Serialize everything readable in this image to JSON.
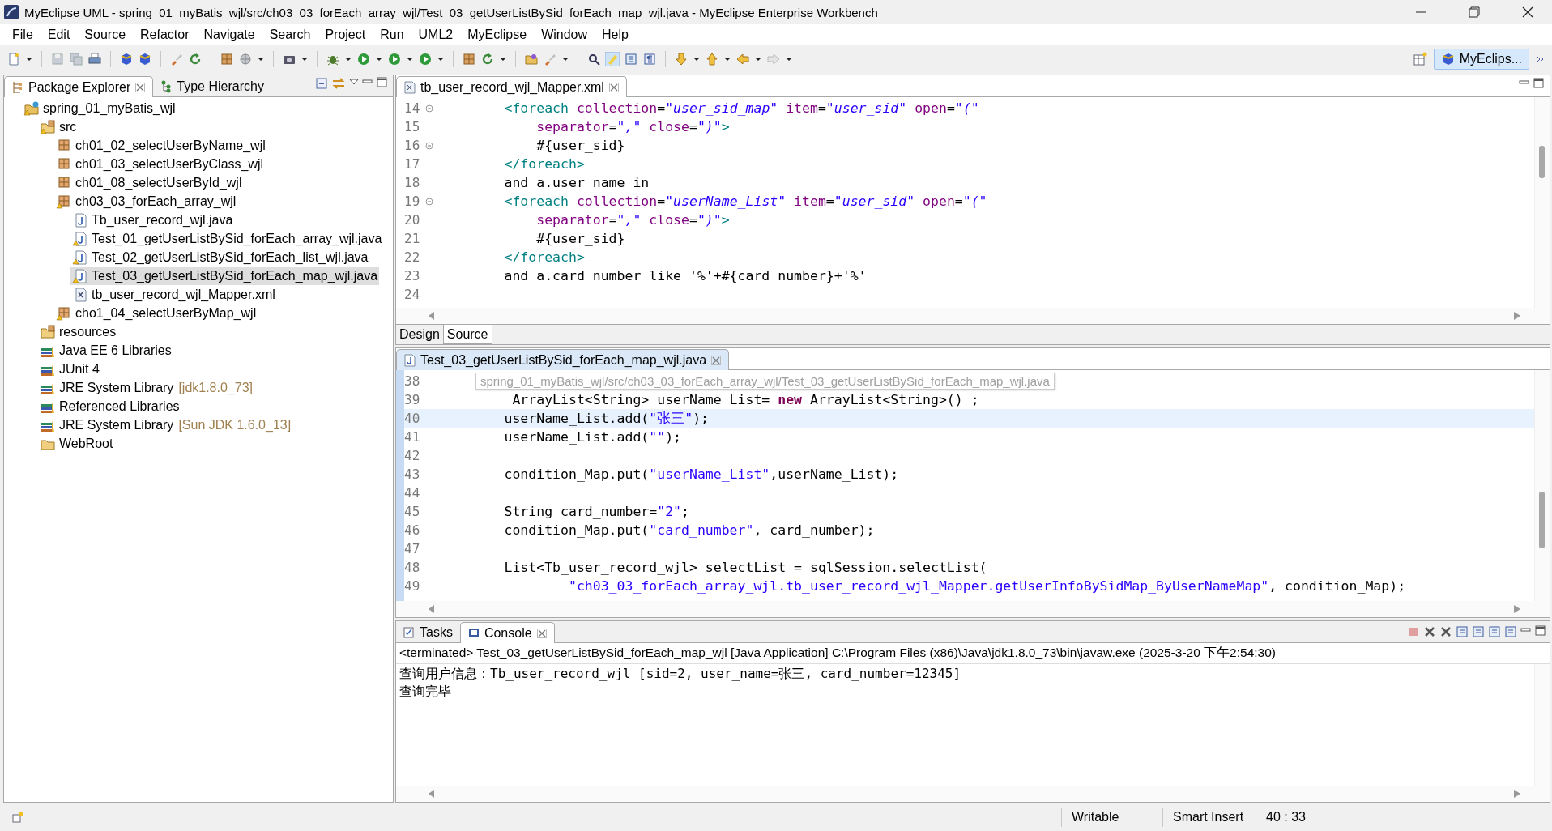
{
  "window": {
    "title": "MyEclipse UML - spring_01_myBatis_wjl/src/ch03_03_forEach_array_wjl/Test_03_getUserListBySid_forEach_map_wjl.java - MyEclipse Enterprise Workbench"
  },
  "menu": [
    "File",
    "Edit",
    "Source",
    "Refactor",
    "Navigate",
    "Search",
    "Project",
    "Run",
    "UML2",
    "MyEclipse",
    "Window",
    "Help"
  ],
  "perspective": {
    "label": "MyEclips...",
    "selected": true
  },
  "explorer": {
    "tabs": [
      {
        "label": "Package Explorer",
        "selected": true
      },
      {
        "label": "Type Hierarchy",
        "selected": false
      }
    ],
    "tree": [
      {
        "label": "spring_01_myBatis_wjl",
        "kind": "project",
        "warning": true,
        "selected": false,
        "children": [
          {
            "label": "src",
            "kind": "source-folder",
            "warning": true,
            "selected": false,
            "children": [
              {
                "label": "ch01_02_selectUserByName_wjl",
                "kind": "package",
                "warning": false,
                "selected": false
              },
              {
                "label": "ch01_03_selectUserByClass_wjl",
                "kind": "package",
                "warning": false,
                "selected": false
              },
              {
                "label": "ch01_08_selectUserById_wjl",
                "kind": "package",
                "warning": false,
                "selected": false
              },
              {
                "label": "ch03_03_forEach_array_wjl",
                "kind": "package",
                "warning": true,
                "selected": false,
                "children": [
                  {
                    "label": "Tb_user_record_wjl.java",
                    "kind": "java",
                    "warning": false,
                    "selected": false
                  },
                  {
                    "label": "Test_01_getUserListBySid_forEach_array_wjl.java",
                    "kind": "java",
                    "warning": true,
                    "selected": false
                  },
                  {
                    "label": "Test_02_getUserListBySid_forEach_list_wjl.java",
                    "kind": "java",
                    "warning": true,
                    "selected": false
                  },
                  {
                    "label": "Test_03_getUserListBySid_forEach_map_wjl.java",
                    "kind": "java",
                    "warning": true,
                    "selected": true
                  },
                  {
                    "label": "tb_user_record_wjl_Mapper.xml",
                    "kind": "xml",
                    "warning": false,
                    "selected": false
                  }
                ]
              },
              {
                "label": "cho1_04_selectUserByMap_wjl",
                "kind": "package",
                "warning": true,
                "selected": false
              }
            ]
          },
          {
            "label": "resources",
            "kind": "source-folder",
            "warning": false,
            "selected": false
          },
          {
            "label": "Java EE 6 Libraries",
            "kind": "library",
            "warning": false,
            "selected": false
          },
          {
            "label": "JUnit 4",
            "kind": "library",
            "warning": false,
            "selected": false
          },
          {
            "label": "JRE System Library",
            "suffix": "[jdk1.8.0_73]",
            "kind": "library",
            "warning": false,
            "selected": false
          },
          {
            "label": "Referenced Libraries",
            "kind": "library",
            "warning": false,
            "selected": false
          },
          {
            "label": "JRE System Library",
            "suffix": "[Sun JDK 1.6.0_13]",
            "kind": "library",
            "warning": false,
            "selected": false
          },
          {
            "label": "WebRoot",
            "kind": "folder",
            "warning": false,
            "selected": false
          }
        ]
      }
    ]
  },
  "xml_editor": {
    "tab": "tb_user_record_wjl_Mapper.xml",
    "lines": [
      {
        "n": "14",
        "fold": true,
        "segs": [
          {
            "kind": "tag",
            "text": "        <foreach"
          },
          {
            "kind": "attr",
            "text": " collection"
          },
          {
            "kind": "text",
            "text": "="
          },
          {
            "kind": "value",
            "text": "\"user_sid_map\""
          },
          {
            "kind": "attr",
            "text": " item"
          },
          {
            "kind": "text",
            "text": "="
          },
          {
            "kind": "value",
            "text": "\"user_sid\""
          },
          {
            "kind": "attr",
            "text": " open"
          },
          {
            "kind": "text",
            "text": "="
          },
          {
            "kind": "value",
            "text": "\"(\""
          }
        ]
      },
      {
        "n": "15",
        "fold": false,
        "segs": [
          {
            "kind": "attr",
            "text": "            separator"
          },
          {
            "kind": "text",
            "text": "="
          },
          {
            "kind": "value",
            "text": "\",\""
          },
          {
            "kind": "attr",
            "text": " close"
          },
          {
            "kind": "text",
            "text": "="
          },
          {
            "kind": "value",
            "text": "\")\""
          },
          {
            "kind": "tag",
            "text": ">"
          }
        ]
      },
      {
        "n": "16",
        "fold": true,
        "segs": [
          {
            "kind": "text",
            "text": "            #{user_sid}"
          }
        ]
      },
      {
        "n": "17",
        "fold": false,
        "segs": [
          {
            "kind": "tag",
            "text": "        </foreach>"
          }
        ]
      },
      {
        "n": "18",
        "fold": false,
        "segs": [
          {
            "kind": "text",
            "text": "        and a.user_name in"
          }
        ]
      },
      {
        "n": "19",
        "fold": true,
        "segs": [
          {
            "kind": "tag",
            "text": "        <foreach"
          },
          {
            "kind": "attr",
            "text": " collection"
          },
          {
            "kind": "text",
            "text": "="
          },
          {
            "kind": "value",
            "text": "\"userName_List\""
          },
          {
            "kind": "attr",
            "text": " item"
          },
          {
            "kind": "text",
            "text": "="
          },
          {
            "kind": "value",
            "text": "\"user_sid\""
          },
          {
            "kind": "attr",
            "text": " open"
          },
          {
            "kind": "text",
            "text": "="
          },
          {
            "kind": "value",
            "text": "\"(\""
          }
        ]
      },
      {
        "n": "20",
        "fold": false,
        "segs": [
          {
            "kind": "attr",
            "text": "            separator"
          },
          {
            "kind": "text",
            "text": "="
          },
          {
            "kind": "value",
            "text": "\",\""
          },
          {
            "kind": "attr",
            "text": " close"
          },
          {
            "kind": "text",
            "text": "="
          },
          {
            "kind": "value",
            "text": "\")\""
          },
          {
            "kind": "tag",
            "text": ">"
          }
        ]
      },
      {
        "n": "21",
        "fold": false,
        "segs": [
          {
            "kind": "text",
            "text": "            #{user_sid}"
          }
        ]
      },
      {
        "n": "22",
        "fold": false,
        "segs": [
          {
            "kind": "tag",
            "text": "        </foreach>"
          }
        ]
      },
      {
        "n": "23",
        "fold": false,
        "segs": [
          {
            "kind": "text",
            "text": "        and a.card_number like '%'+#{card_number}+'%'"
          }
        ]
      },
      {
        "n": "24",
        "fold": false
      }
    ],
    "mode_tabs": [
      {
        "label": "Design",
        "selected": false
      },
      {
        "label": "Source",
        "selected": true
      }
    ]
  },
  "java_editor": {
    "tab": "Test_03_getUserListBySid_forEach_map_wjl.java",
    "tooltip": "spring_01_myBatis_wjl/src/ch03_03_forEach_array_wjl/Test_03_getUserListBySid_forEach_map_wjl.java",
    "lines": [
      {
        "n": "38",
        "highlighted": false
      },
      {
        "n": "39",
        "highlighted": false,
        "segs": [
          {
            "kind": "text",
            "text": "         ArrayList<String> userName_List= "
          },
          {
            "kind": "kw",
            "text": "new"
          },
          {
            "kind": "text",
            "text": " ArrayList<String>() ;"
          }
        ]
      },
      {
        "n": "40",
        "highlighted": true,
        "segs": [
          {
            "kind": "text",
            "text": "        userName_List.add("
          },
          {
            "kind": "str",
            "text": "\"张三\""
          },
          {
            "kind": "text",
            "text": ");"
          }
        ]
      },
      {
        "n": "41",
        "highlighted": false,
        "segs": [
          {
            "kind": "text",
            "text": "        userName_List.add("
          },
          {
            "kind": "str",
            "text": "\"\""
          },
          {
            "kind": "text",
            "text": ");"
          }
        ]
      },
      {
        "n": "42",
        "highlighted": false
      },
      {
        "n": "43",
        "highlighted": false,
        "segs": [
          {
            "kind": "text",
            "text": "        condition_Map.put("
          },
          {
            "kind": "str",
            "text": "\"userName_List\""
          },
          {
            "kind": "text",
            "text": ",userName_List);"
          }
        ]
      },
      {
        "n": "44",
        "highlighted": false
      },
      {
        "n": "45",
        "highlighted": false,
        "segs": [
          {
            "kind": "text",
            "text": "        String card_number="
          },
          {
            "kind": "str",
            "text": "\"2\""
          },
          {
            "kind": "text",
            "text": ";"
          }
        ]
      },
      {
        "n": "46",
        "highlighted": false,
        "segs": [
          {
            "kind": "text",
            "text": "        condition_Map.put("
          },
          {
            "kind": "str",
            "text": "\"card_number\""
          },
          {
            "kind": "text",
            "text": ", card_number);"
          }
        ]
      },
      {
        "n": "47",
        "highlighted": false
      },
      {
        "n": "48",
        "highlighted": false,
        "segs": [
          {
            "kind": "text",
            "text": "        List<Tb_user_record_wjl> selectList = sqlSession.selectList("
          }
        ]
      },
      {
        "n": "49",
        "highlighted": false,
        "segs": [
          {
            "kind": "str",
            "text": "                \"ch03_03_forEach_array_wjl.tb_user_record_wjl_Mapper.getUserInfoBySidMap_ByUserNameMap\""
          },
          {
            "kind": "text",
            "text": ", condition_Map);"
          }
        ]
      }
    ]
  },
  "console": {
    "tabs": [
      {
        "label": "Tasks",
        "selected": false
      },
      {
        "label": "Console",
        "selected": true
      }
    ],
    "header": "<terminated> Test_03_getUserListBySid_forEach_map_wjl [Java Application] C:\\Program Files (x86)\\Java\\jdk1.8.0_73\\bin\\javaw.exe (2025-3-20 下午2:54:30)",
    "output": [
      "查询用户信息：Tb_user_record_wjl [sid=2, user_name=张三, card_number=12345]",
      "查询完毕"
    ]
  },
  "status_bar": [
    "Writable",
    "Smart Insert",
    "40 : 33"
  ]
}
